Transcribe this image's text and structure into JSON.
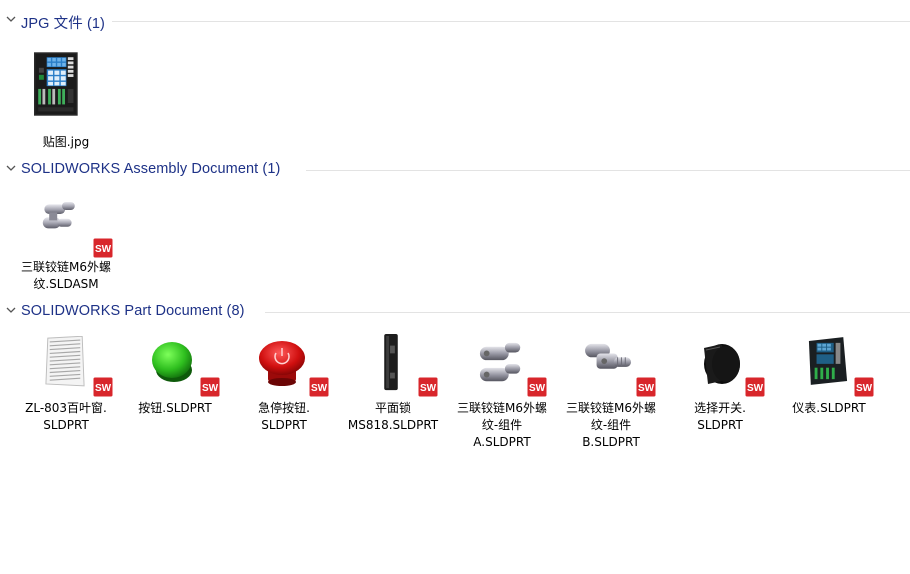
{
  "groups": [
    {
      "title": "JPG 文件 (1)",
      "items": [
        {
          "label_lines": [
            "贴图.jpg"
          ],
          "icon": "control-panel-photo-thumbnail"
        }
      ]
    },
    {
      "title": "SOLIDWORKS Assembly Document (1)",
      "items": [
        {
          "label_lines": [
            "三联铰链M6外螺",
            "纹.SLDASM"
          ],
          "icon": "hinge-assembly-thumbnail"
        }
      ]
    },
    {
      "title": "SOLIDWORKS Part Document (8)",
      "items": [
        {
          "label_lines": [
            "ZL-803百叶窗.",
            "SLDPRT"
          ],
          "icon": "louver-thumbnail"
        },
        {
          "label_lines": [
            "按钮.SLDPRT"
          ],
          "icon": "green-button-thumbnail"
        },
        {
          "label_lines": [
            "急停按钮.",
            "SLDPRT"
          ],
          "icon": "emergency-stop-thumbnail"
        },
        {
          "label_lines": [
            "平面锁",
            "MS818.SLDPRT"
          ],
          "icon": "flat-lock-thumbnail"
        },
        {
          "label_lines": [
            "三联铰链M6外螺",
            "纹-组件",
            "A.SLDPRT"
          ],
          "icon": "hinge-part-a-thumbnail"
        },
        {
          "label_lines": [
            "三联铰链M6外螺",
            "纹-组件",
            "B.SLDPRT"
          ],
          "icon": "hinge-part-b-thumbnail"
        },
        {
          "label_lines": [
            "选择开关.",
            "SLDPRT"
          ],
          "icon": "selector-switch-thumbnail"
        },
        {
          "label_lines": [
            "仪表.SLDPRT"
          ],
          "icon": "meter-panel-thumbnail"
        }
      ]
    }
  ],
  "colors": {
    "group_title": "#1e3287",
    "divider": "#e3e3e3",
    "sw_red": "#d8262b"
  }
}
